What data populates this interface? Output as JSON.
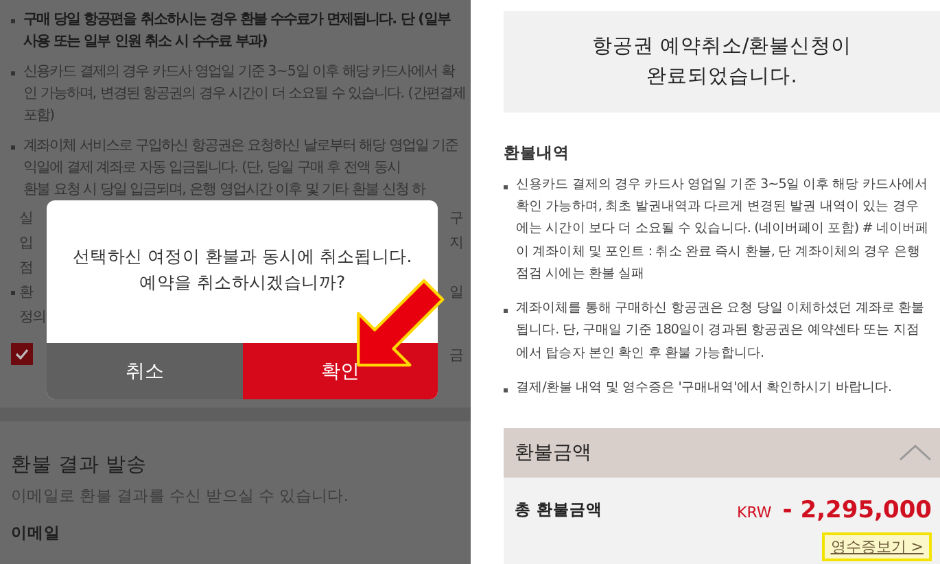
{
  "left_screen": {
    "notices": [
      {
        "text": "구매 당일 항공편을 취소하시는 경우 환불 수수료가 면제됩니다. 단 (일부 사용 또는 일부 인원 취소 시 수수료 부과)",
        "bold": true
      },
      {
        "text": "신용카드 결제의 경우 카드사 영업일 기준 3~5일 이후 해당 카드사에서 확인 가능하며, 변경된 항공권의 경우 시간이 더 소요될 수 있습니다. (간편결제 포함)",
        "bold": false
      },
      {
        "text": "계좌이체 서비스로 구입하신 항공권은 요청하신 날로부터 해당 영업일 기준 익일에 결제 계좌로 자동 입금됩니다. (단, 당일 구매 후 전액 동시",
        "bold": false
      }
    ],
    "partial_line": "환불 요청 시 당일 입금되며, 은행 영업시간 이후 및 기타 환불 신청 하",
    "fragments": [
      {
        "left": "실",
        "right": "구",
        "bullet": false
      },
      {
        "left": "입",
        "right": "지",
        "bullet": false
      },
      {
        "left": "점",
        "bullet": false
      },
      {
        "left": "환",
        "right": "일",
        "bullet": true
      },
      {
        "left": "정의",
        "bullet": false
      }
    ],
    "agree_row": {
      "checked": true,
      "right": "금"
    },
    "dialog": {
      "message": "선택하신 여정이 환불과 동시에 취소됩니다.\n예약을 취소하시겠습니까?",
      "buttons": [
        {
          "label": "취소",
          "kind": "secondary"
        },
        {
          "label": "확인",
          "kind": "primary"
        }
      ]
    },
    "result_section": {
      "title": "환불 결과 발송",
      "description": "이메일로 환불 결과를 수신 받으실 수 있습니다.",
      "field_label": "이메일"
    }
  },
  "right_screen": {
    "banner": "항공권 예약취소/환불신청이\n완료되었습니다.",
    "details_title": "환불내역",
    "details": [
      "신용카드 결제의 경우 카드사 영업일 기준 3~5일 이후 해당 카드사에서 확인 가능하며, 최초 발권내역과 다르게 변경된 발권 내역이 있는 경우에는 시간이 보다 더 소요될 수 있습니다. (네이버페이 포함) # 네이버페이 계좌이체 및 포인트 : 취소 완료 즉시 환불, 단 계좌이체의 경우 은행 점검 시에는 환불 실패",
      "계좌이체를 통해 구매하신 항공권은 요청 당일 이체하셨던 계좌로 환불됩니다. 단, 구매일 기준 180일이 경과된 항공권은 예약센타 또는 지점에서 탑승자 본인 확인 후 환불 가능합니다.",
      "결제/환불 내역 및 영수증은 '구매내역'에서 확인하시기 바랍니다."
    ],
    "amount_panel": {
      "title": "환불금액",
      "expanded": true,
      "label": "총 환불금액",
      "currency": "KRW",
      "amount": "- 2,295,000",
      "receipt_link": "영수증보기 >"
    }
  }
}
